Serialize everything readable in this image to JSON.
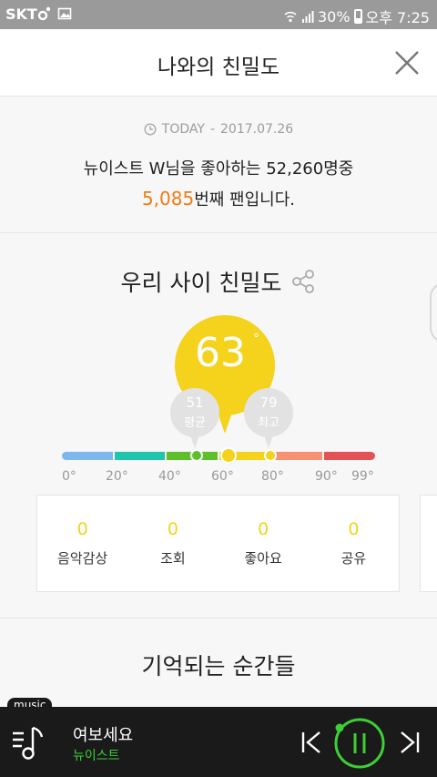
{
  "status_bar": {
    "carrier": "SKT",
    "battery": "30%",
    "time": "오후 7:25"
  },
  "header": {
    "title": "나와의 친밀도"
  },
  "today": {
    "label": "TODAY",
    "separator": "-",
    "date": "2017.07.26",
    "message_prefix": "뉴이스트 W님을 좋아하는 52,260명중",
    "rank": "5,085",
    "message_suffix": "번째 팬입니다."
  },
  "intimacy": {
    "title": "우리 사이 친밀도",
    "score": "63",
    "degree": "°",
    "average": {
      "value": "51",
      "label": "평균"
    },
    "best": {
      "value": "79",
      "label": "최고"
    },
    "scale_levels": {
      "score": 63,
      "average": 51,
      "best": 79,
      "min": 0,
      "max": 99
    },
    "scale_colors": [
      "#7eb6ee",
      "#21c5ad",
      "#5dc02a",
      "#f5d21b",
      "#f79174",
      "#e35356"
    ],
    "ticks": [
      "0°",
      "20°",
      "40°",
      "60°",
      "80°",
      "90°",
      "99°"
    ],
    "stats": [
      {
        "value": "0",
        "label": "음악감상"
      },
      {
        "value": "0",
        "label": "조회"
      },
      {
        "value": "0",
        "label": "좋아요"
      },
      {
        "value": "0",
        "label": "공유"
      }
    ]
  },
  "memories": {
    "title": "기억되는 순간들"
  },
  "player": {
    "badge": "music",
    "song": "여보세요",
    "artist": "뉴이스트",
    "accent": "#3cd034"
  }
}
